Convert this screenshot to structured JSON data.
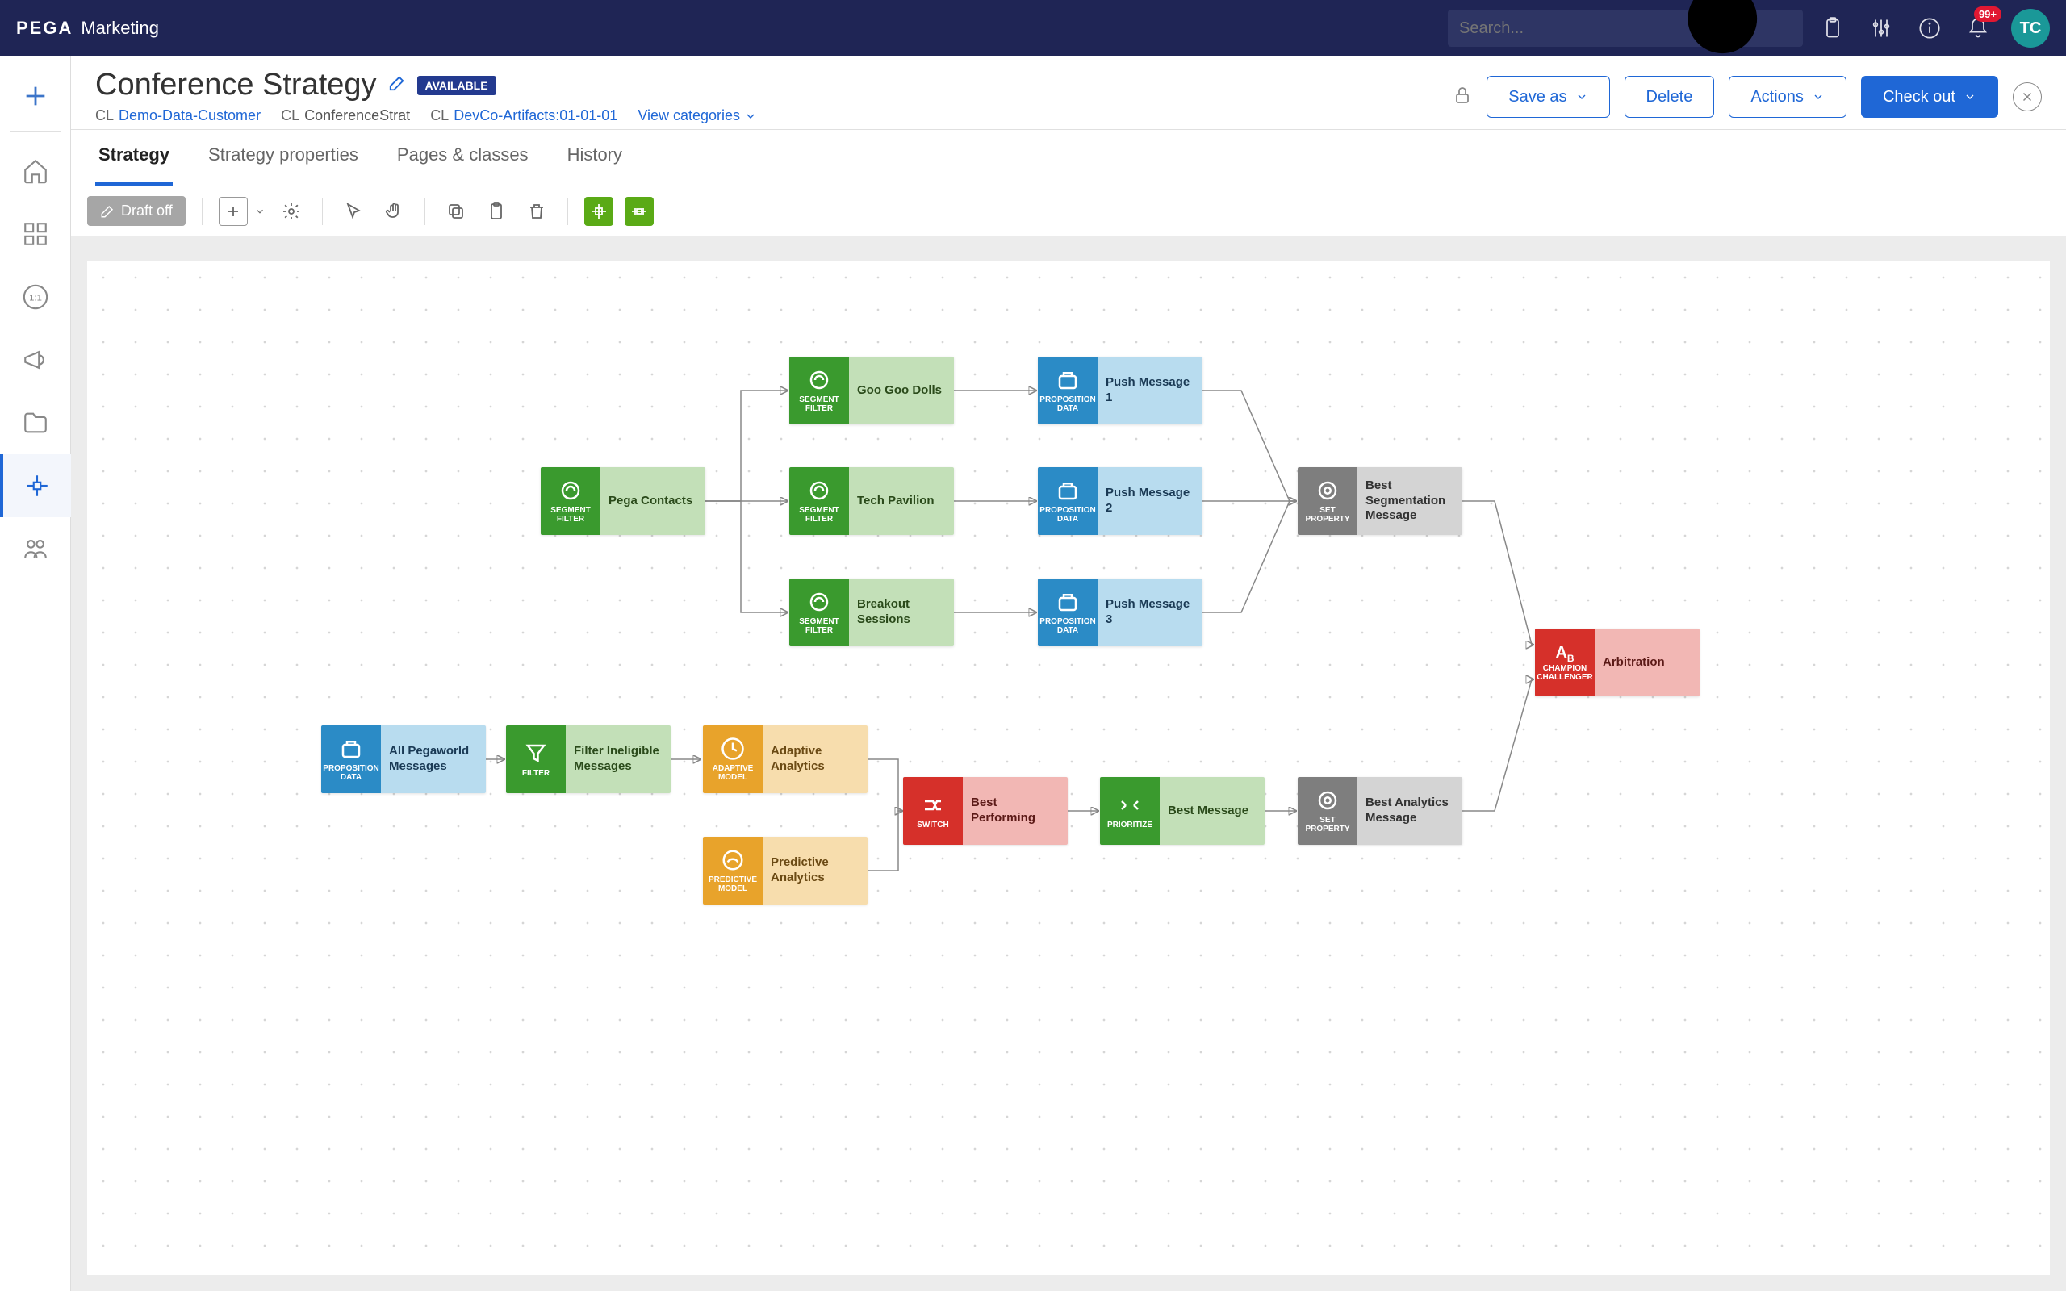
{
  "brand": {
    "name": "PEGA",
    "product": "Marketing"
  },
  "search": {
    "placeholder": "Search..."
  },
  "notifications": {
    "count": "99+"
  },
  "avatar": "TC",
  "header": {
    "title": "Conference Strategy",
    "status": "AVAILABLE",
    "crumbs": {
      "cl1": "CL",
      "link1": "Demo-Data-Customer",
      "cl2": "CL",
      "name": "ConferenceStrat",
      "cl3": "CL",
      "link3": "DevCo-Artifacts:01-01-01",
      "view_categories": "View categories"
    },
    "buttons": {
      "save_as": "Save as",
      "delete": "Delete",
      "actions": "Actions",
      "checkout": "Check out"
    }
  },
  "tabs": {
    "strategy": "Strategy",
    "properties": "Strategy properties",
    "pages": "Pages & classes",
    "history": "History"
  },
  "toolbar": {
    "draft": "Draft off"
  },
  "nodes": {
    "pega_contacts": {
      "label": "Pega Contacts",
      "type": "SEGMENT FILTER"
    },
    "goo_goo": {
      "label": "Goo Goo Dolls",
      "type": "SEGMENT FILTER"
    },
    "tech_pav": {
      "label": "Tech Pavilion",
      "type": "SEGMENT FILTER"
    },
    "breakout": {
      "label": "Breakout Sessions",
      "type": "SEGMENT FILTER"
    },
    "push1": {
      "label": "Push Message 1",
      "type": "PROPOSITION DATA"
    },
    "push2": {
      "label": "Push Message 2",
      "type": "PROPOSITION DATA"
    },
    "push3": {
      "label": "Push Message 3",
      "type": "PROPOSITION DATA"
    },
    "best_seg": {
      "label": "Best Segmentation Message",
      "type": "SET PROPERTY"
    },
    "all_pw": {
      "label": "All Pegaworld Messages",
      "type": "PROPOSITION DATA"
    },
    "filter_inel": {
      "label": "Filter Ineligible Messages",
      "type": "FILTER"
    },
    "adaptive": {
      "label": "Adaptive Analytics",
      "type": "ADAPTIVE MODEL"
    },
    "predictive": {
      "label": "Predictive Analytics",
      "type": "PREDICTIVE MODEL"
    },
    "best_perf": {
      "label": "Best Performing",
      "type": "SWITCH"
    },
    "best_msg": {
      "label": "Best Message",
      "type": "PRIORITIZE"
    },
    "best_anal": {
      "label": "Best Analytics Message",
      "type": "SET PROPERTY"
    },
    "arbitration": {
      "label": "Arbitration",
      "type": "CHAMPION CHALLENGER"
    }
  }
}
